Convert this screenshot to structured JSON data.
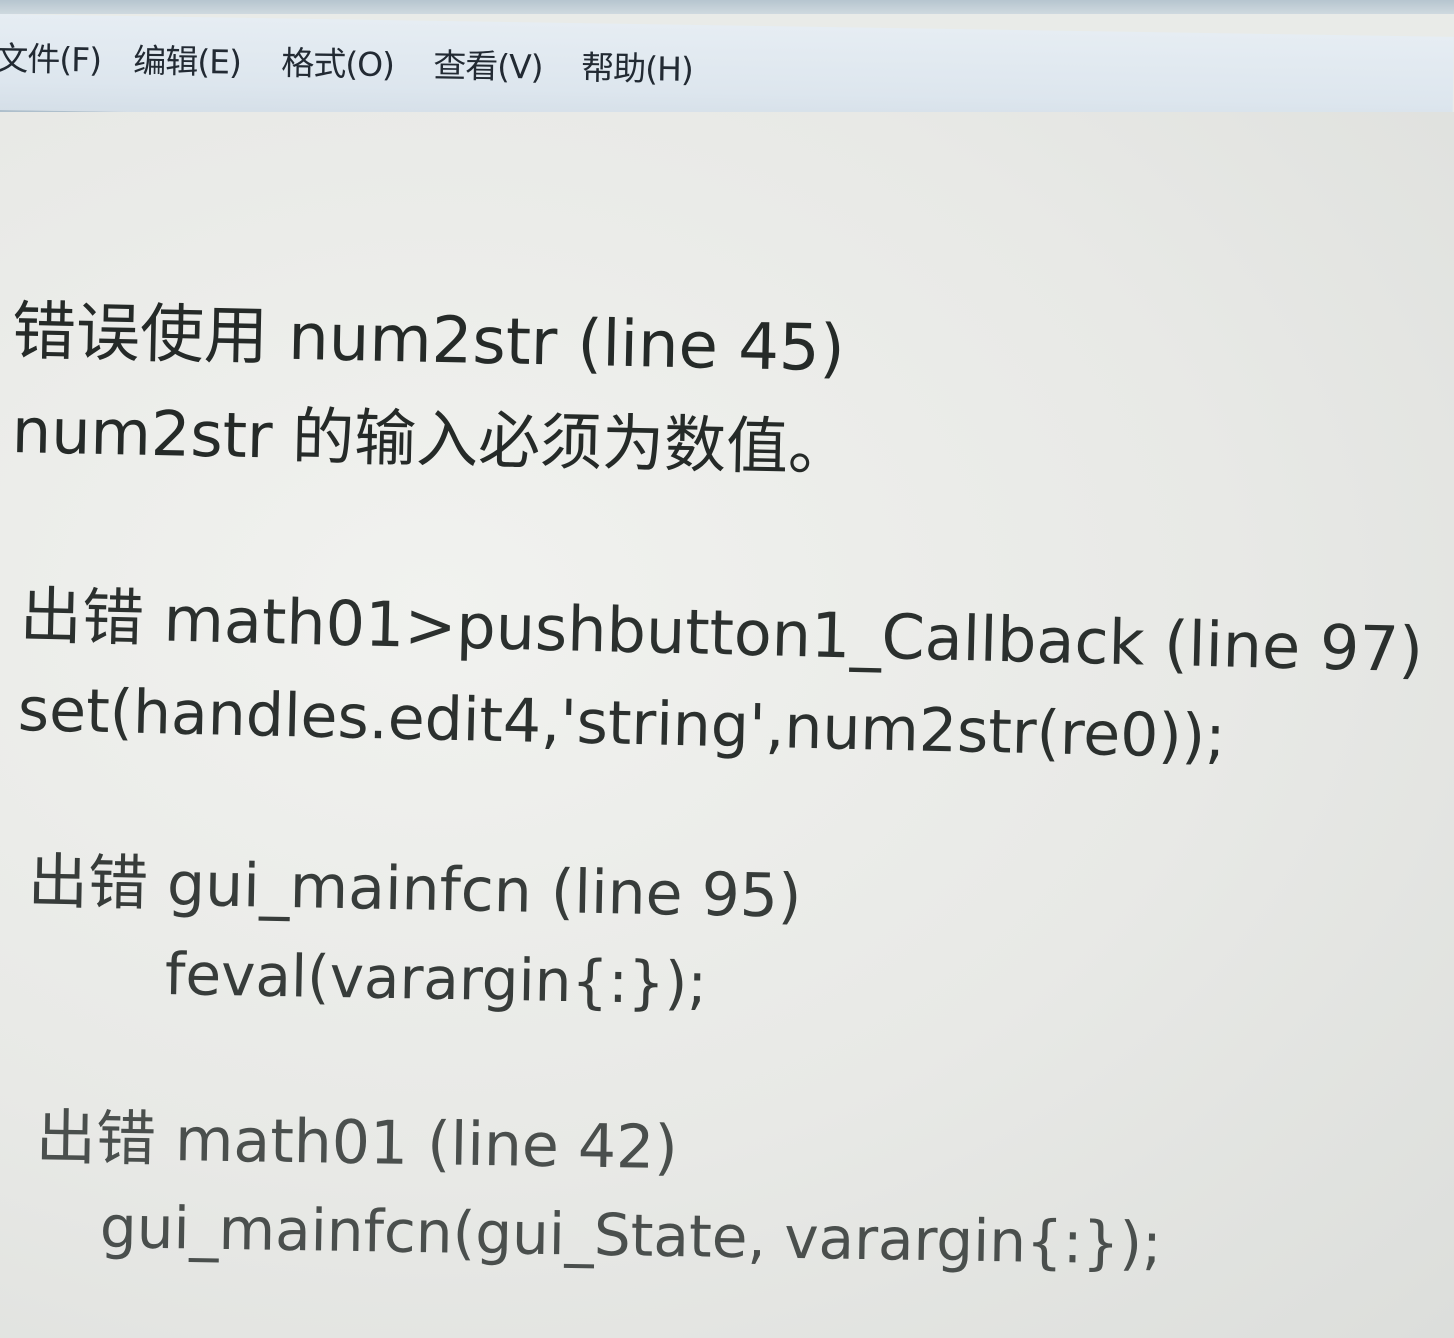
{
  "menu": {
    "file": "文件(F)",
    "edit": "编辑(E)",
    "format": "格式(O)",
    "view": "查看(V)",
    "help": "帮助(H)"
  },
  "document": {
    "lines": [
      "错误使用 num2str (line 45)",
      "num2str 的输入必须为数值。",
      "出错 math01>pushbutton1_Callback (line 97)",
      "set(handles.edit4,'string',num2str(re0));",
      "出错 gui_mainfcn (line 95)",
      "feval(varargin{:});",
      "出错 math01 (line 42)",
      "gui_mainfcn(gui_State, varargin{:});"
    ]
  }
}
